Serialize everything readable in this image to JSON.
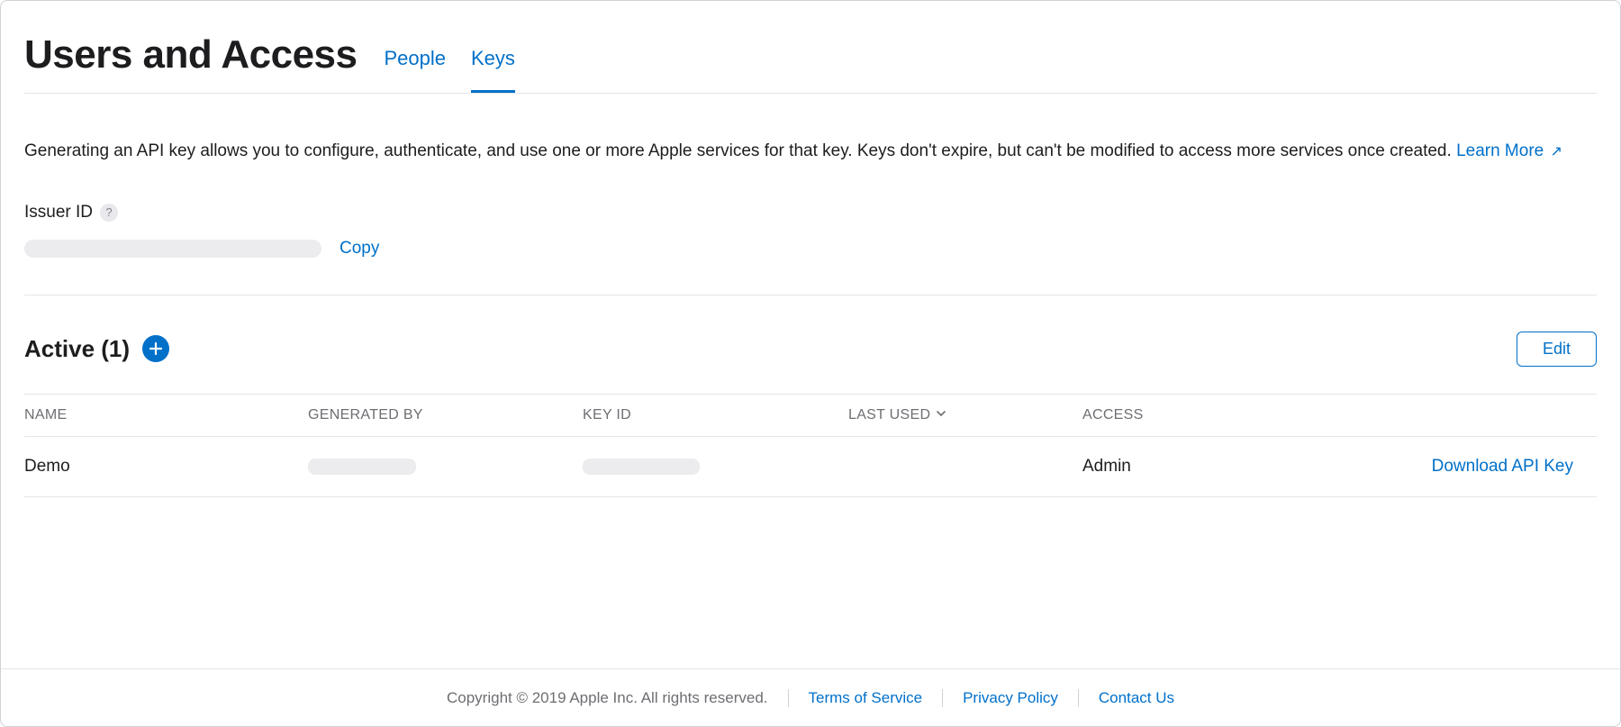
{
  "header": {
    "title": "Users and Access",
    "tabs": [
      {
        "label": "People",
        "active": false
      },
      {
        "label": "Keys",
        "active": true
      }
    ]
  },
  "description": {
    "text": "Generating an API key allows you to configure, authenticate, and use one or more Apple services for that key. Keys don't expire, but can't be modified to access more services once created.",
    "learn_more_label": "Learn More"
  },
  "issuer": {
    "label": "Issuer ID",
    "help_symbol": "?",
    "value_redacted": true,
    "copy_label": "Copy"
  },
  "active_section": {
    "title": "Active (1)",
    "edit_label": "Edit"
  },
  "table": {
    "columns": {
      "name": "NAME",
      "generated_by": "GENERATED BY",
      "key_id": "KEY ID",
      "last_used": "LAST USED",
      "access": "ACCESS"
    },
    "rows": [
      {
        "name": "Demo",
        "generated_by_redacted": true,
        "key_id_redacted": true,
        "last_used": "",
        "access": "Admin",
        "download_label": "Download API Key"
      }
    ]
  },
  "footer": {
    "copyright": "Copyright © 2019 Apple Inc. All rights reserved.",
    "links": {
      "terms": "Terms of Service",
      "privacy": "Privacy Policy",
      "contact": "Contact Us"
    }
  }
}
